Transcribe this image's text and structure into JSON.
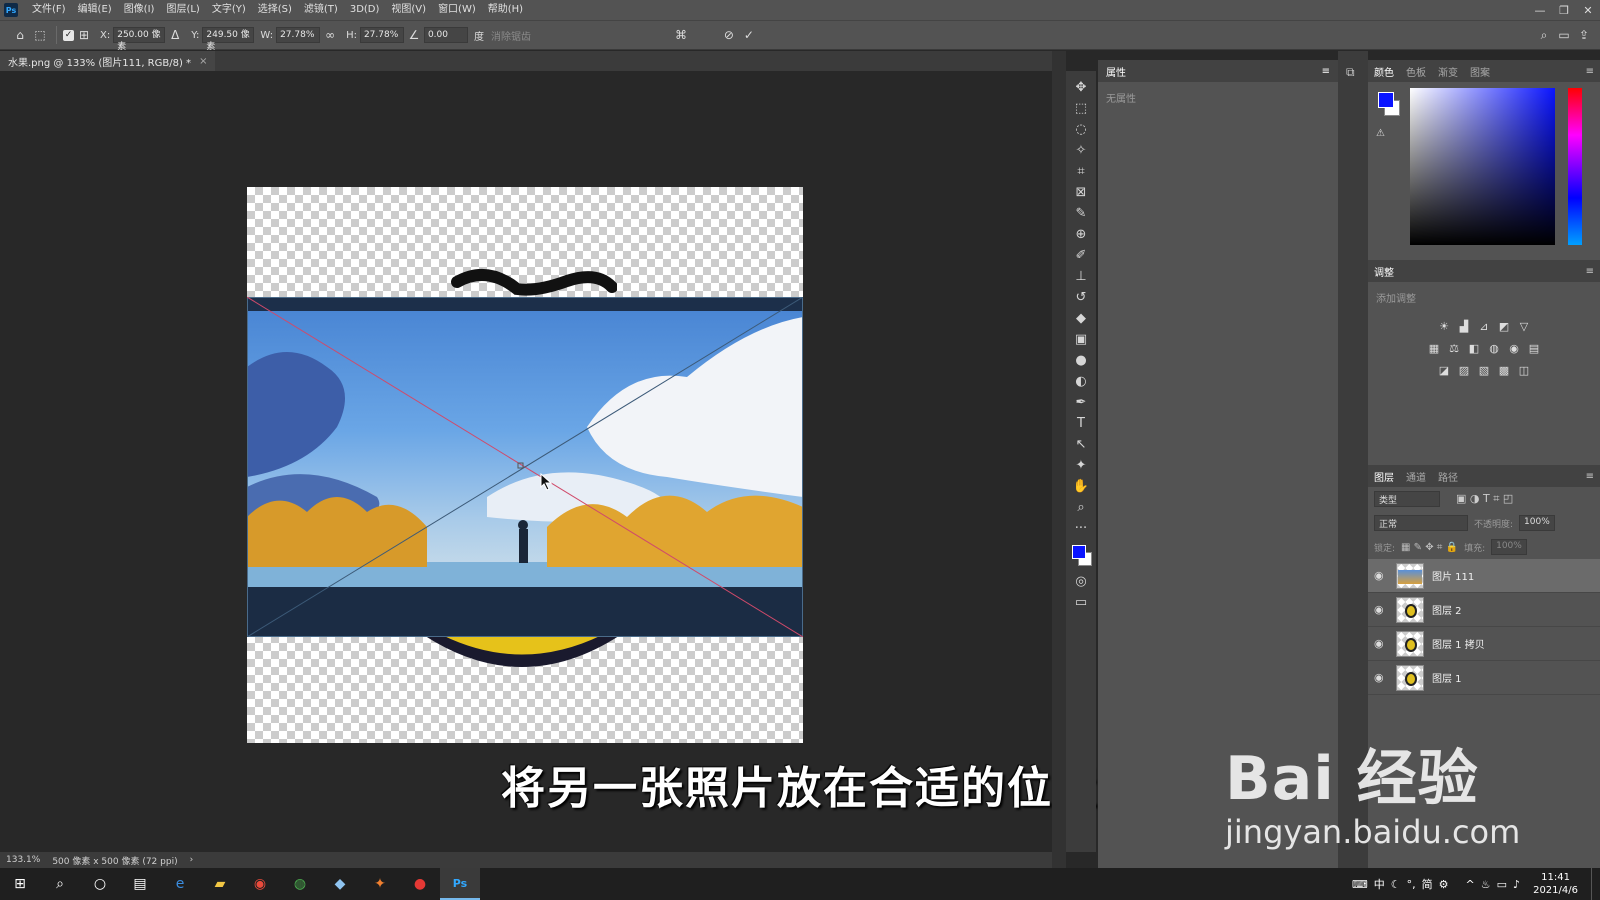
{
  "menubar": {
    "items": [
      "文件(F)",
      "编辑(E)",
      "图像(I)",
      "图层(L)",
      "文字(Y)",
      "选择(S)",
      "滤镜(T)",
      "3D(D)",
      "视图(V)",
      "窗口(W)",
      "帮助(H)"
    ],
    "logo": "Ps",
    "win_minimize": "—",
    "win_restore": "❐",
    "win_close": "✕"
  },
  "options": {
    "x_label": "X:",
    "x_value": "250.00 像素",
    "y_label": "Y:",
    "y_value": "249.50 像素",
    "w_label": "W:",
    "w_value": "27.78%",
    "h_label": "H:",
    "h_value": "27.78%",
    "angle_value": "0.00",
    "angle_unit": "度",
    "interp_label": "消除锯齿"
  },
  "document": {
    "tab_title": "水果.png @ 133% (图片111, RGB/8) *",
    "tab_close": "×"
  },
  "status": {
    "zoom": "133.1%",
    "doc_info": "500 像素 x 500 像素 (72 ppi)",
    "arrow": "›"
  },
  "subtitle": "将另一张照片放在合适的位置",
  "properties": {
    "title": "属性",
    "empty": "无属性"
  },
  "color_panel": {
    "tabs": [
      "颜色",
      "色板",
      "渐变",
      "图案"
    ]
  },
  "adjust_panel": {
    "title": "调整",
    "sub": "添加调整"
  },
  "layers_panel": {
    "tabs": [
      "图层",
      "通道",
      "路径"
    ],
    "search_placeholder": "类型",
    "blend_mode": "正常",
    "opacity_label": "不透明度:",
    "opacity_value": "100%",
    "lock_label": "锁定:",
    "fill_label": "填充:",
    "fill_value": "100%",
    "layers": [
      {
        "name": "图片 111",
        "selected": true
      },
      {
        "name": "图层 2",
        "selected": false
      },
      {
        "name": "图层 1 拷贝",
        "selected": false
      },
      {
        "name": "图层 1",
        "selected": false
      }
    ]
  },
  "taskbar": {
    "time": "11:41",
    "date": "2021/4/6",
    "ime": "中",
    "ime2": "简"
  },
  "watermark": {
    "main": "Bai 经验",
    "url": "jingyan.baidu.com"
  },
  "colors": {
    "accent": "#0a14ff",
    "ui_bg": "#535353",
    "canvas_bg": "#282828"
  }
}
